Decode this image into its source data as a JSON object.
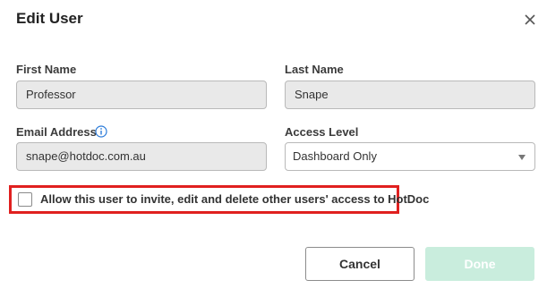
{
  "dialog": {
    "title": "Edit User",
    "close_icon": "close-icon"
  },
  "fields": {
    "first_name": {
      "label": "First Name",
      "value": "Professor"
    },
    "last_name": {
      "label": "Last Name",
      "value": "Snape"
    },
    "email": {
      "label": "Email Address",
      "value": "snape@hotdoc.com.au",
      "info_icon": "info-icon"
    },
    "access_level": {
      "label": "Access Level",
      "value": "Dashboard Only"
    }
  },
  "permission": {
    "label": "Allow this user to invite, edit and delete other users' access to HotDoc",
    "checked": false,
    "highlight_color": "#e0201f"
  },
  "actions": {
    "cancel_label": "Cancel",
    "done_label": "Done",
    "done_color": "#c9eddd"
  }
}
